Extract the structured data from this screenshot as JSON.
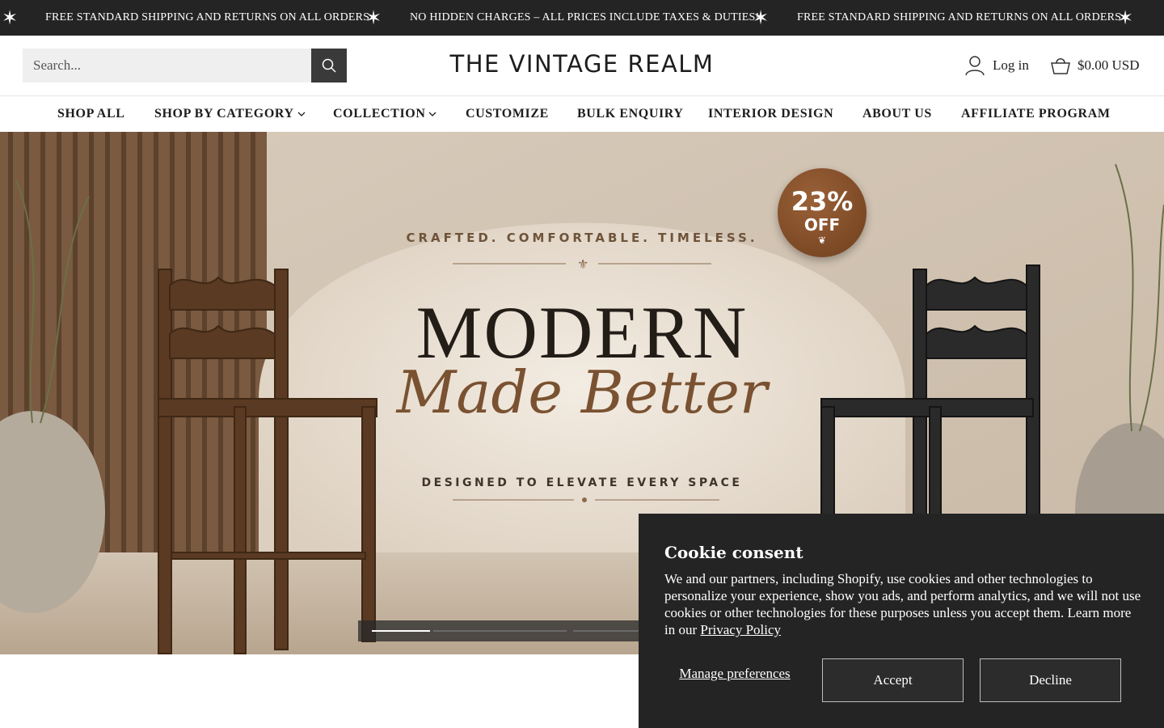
{
  "announcement": {
    "messages": [
      "FREE STANDARD SHIPPING AND RETURNS ON ALL ORDERS",
      "NO HIDDEN CHARGES – ALL PRICES INCLUDE TAXES & DUTIES!",
      "FREE STANDARD SHIPPING AND RETURNS ON ALL ORDERS"
    ],
    "separator_icon": "star-icon"
  },
  "header": {
    "search_placeholder": "Search...",
    "logo": "THE VINTAGE REALM",
    "login_label": "Log in",
    "cart_total": "$0.00 USD"
  },
  "nav": {
    "items": [
      {
        "label": "SHOP ALL",
        "dropdown": false
      },
      {
        "label": "SHOP BY CATEGORY",
        "dropdown": true
      },
      {
        "label": "COLLECTION",
        "dropdown": true
      },
      {
        "label": "CUSTOMIZE",
        "dropdown": false
      },
      {
        "label": "BULK ENQUIRY",
        "dropdown": false
      },
      {
        "label": "INTERIOR DESIGN",
        "dropdown": false
      },
      {
        "label": "ABOUT US",
        "dropdown": false
      },
      {
        "label": "AFFILIATE PROGRAM",
        "dropdown": false
      }
    ]
  },
  "hero": {
    "tagline": "CRAFTED. COMFORTABLE. TIMELESS.",
    "headline": "MODERN",
    "script": "Made Better",
    "subline": "DESIGNED TO ELEVATE EVERY SPACE",
    "badge": {
      "percent": "23%",
      "off": "OFF"
    },
    "slides": {
      "count": 3,
      "active": 0
    }
  },
  "cookie": {
    "title": "Cookie consent",
    "text": "We and our partners, including Shopify, use cookies and other technologies to personalize your experience, show you ads, and perform analytics, and we will not use cookies or other technologies for these purposes unless you accept them. Learn more in our",
    "link": "Privacy Policy",
    "manage": "Manage preferences",
    "accept": "Accept",
    "decline": "Decline"
  },
  "colors": {
    "dark": "#242424",
    "accent_brown": "#7a5231",
    "badge": "#8a5530"
  }
}
